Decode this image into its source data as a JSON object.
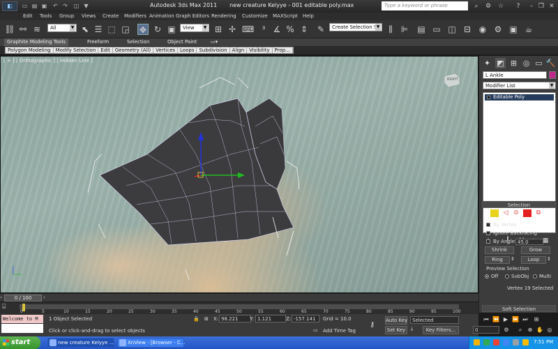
{
  "window": {
    "app_title": "Autodesk 3ds Max  2011",
    "file_title": "new creature Kelyye  - 001 editable poly.max",
    "search_placeholder": "Type a keyword or phrase",
    "quick_access": [
      "new-icon",
      "open-icon",
      "save-icon",
      "undo-icon",
      "redo-icon",
      "hold-icon",
      "project-icon"
    ]
  },
  "menu": [
    "Edit",
    "Tools",
    "Group",
    "Views",
    "Create",
    "Modifiers",
    "Animation",
    "Graph Editors",
    "Rendering",
    "Customize",
    "MAXScript",
    "Help"
  ],
  "toolbar": {
    "selection_filter": "All",
    "reference_coord": "View",
    "named_selection": "Create Selection Se"
  },
  "ribbon": {
    "tabs": [
      "Graphite Modeling Tools",
      "Freeform",
      "Selection",
      "Object Paint"
    ],
    "subtabs": [
      "Polygon Modeling",
      "Modify Selection",
      "Edit",
      "Geometry (All)",
      "Vertices",
      "Loops",
      "Subdivision",
      "Align",
      "Visibility",
      "Prop..."
    ]
  },
  "viewport": {
    "label": "[ + ] [ Orthographic ] [ Hidden Line ]",
    "viewcube_label": "RIGHT"
  },
  "command_panel": {
    "object_name": "L Ankle",
    "object_color": "#c2258a",
    "modifier_list": "Modifier List",
    "stack_item": "Editable Poly",
    "selection_header": "Selection",
    "by_vertex": "By Vertex",
    "ignore_backfacing": "Ignore Backfacing",
    "by_angle": "By Angle:",
    "by_angle_value": "45.0",
    "shrink": "Shrink",
    "grow": "Grow",
    "ring": "Ring",
    "loop": "Loop",
    "preview_selection": "Preview Selection",
    "preview_off": "Off",
    "preview_subobj": "SubObj",
    "preview_multi": "Multi",
    "selection_status": "Vertex 19 Selected",
    "soft_selection": "Soft Selection"
  },
  "timeline": {
    "current_frame": "0 / 100",
    "ticks": [
      "0",
      "5",
      "10",
      "15",
      "20",
      "25",
      "30",
      "35",
      "40",
      "45",
      "50",
      "55",
      "60",
      "65",
      "70",
      "75",
      "80",
      "85",
      "90",
      "95",
      "100"
    ]
  },
  "status": {
    "listener": "Welcome to M",
    "objects_selected": "1 Object Selected",
    "prompt": "Click or click-and-drag to select objects",
    "x_label": "X:",
    "x_value": "98.221",
    "y_label": "Y:",
    "y_value": "1.121",
    "z_label": "Z:",
    "z_value": "-157.141",
    "grid": "Grid = 10.0",
    "add_time_tag": "Add Time Tag",
    "auto_key": "Auto Key",
    "set_key": "Set Key",
    "key_mode": "Selected",
    "key_filters": "Key Filters...",
    "frame_field": "0"
  },
  "taskbar": {
    "start": "start",
    "tasks": [
      "new creature Kelyye ...",
      "XnView - [Browser - C..."
    ],
    "clock": "7:51 PM"
  }
}
